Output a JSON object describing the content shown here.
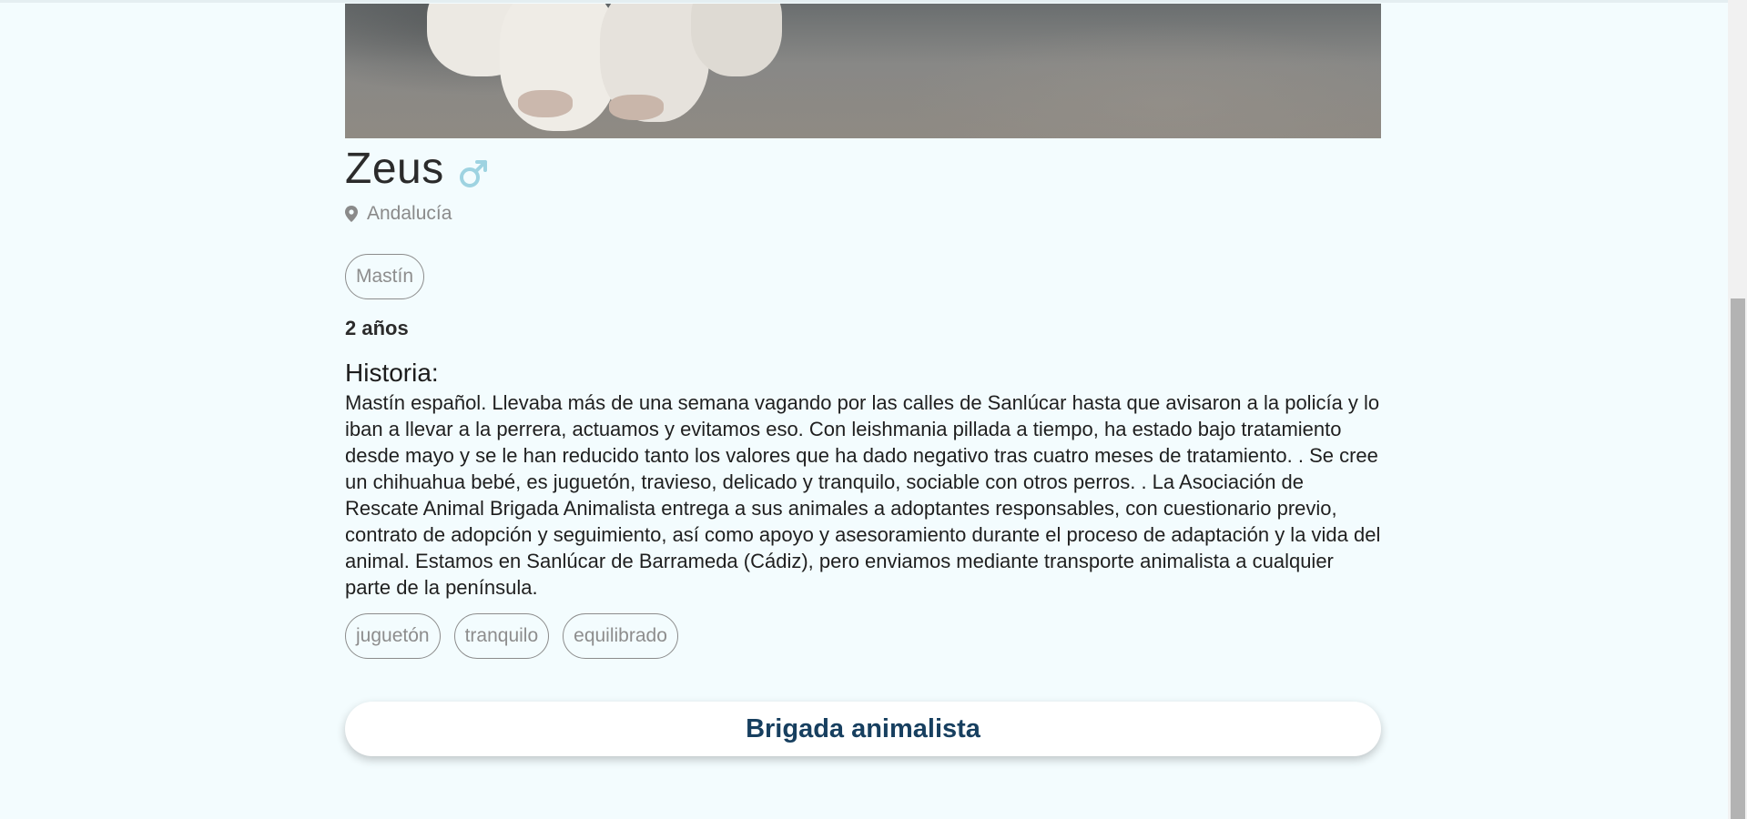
{
  "pet": {
    "name": "Zeus",
    "gender_icon": "male-symbol-icon",
    "location": "Andalucía",
    "breed": "Mastín",
    "age": "2 años"
  },
  "story": {
    "heading": "Historia:",
    "text": "Mastín español. Llevaba más de una semana vagando por las calles de Sanlúcar hasta que avisaron a la policía y lo iban a llevar a la perrera, actuamos y evitamos eso. Con leishmania pillada a tiempo, ha estado bajo tratamiento desde mayo y se le han reducido tanto los valores que ha dado negativo tras cuatro meses de tratamiento. . Se cree un chihuahua bebé, es juguetón, travieso, delicado y tranquilo, sociable con otros perros. . La Asociación de Rescate Animal Brigada Animalista entrega a sus animales a adoptantes responsables, con cuestionario previo, contrato de adopción y seguimiento, así como apoyo y asesoramiento durante el proceso de adaptación y la vida del animal. Estamos en Sanlúcar de Barrameda (Cádiz), pero enviamos mediante transporte animalista a cualquier parte de la península."
  },
  "traits": [
    "juguetón",
    "tranquilo",
    "equilibrado"
  ],
  "organization": {
    "button_label": "Brigada animalista"
  },
  "colors": {
    "background": "#f3fcfe",
    "gender_icon": "#9ed3e1",
    "org_text": "#173f5f"
  }
}
